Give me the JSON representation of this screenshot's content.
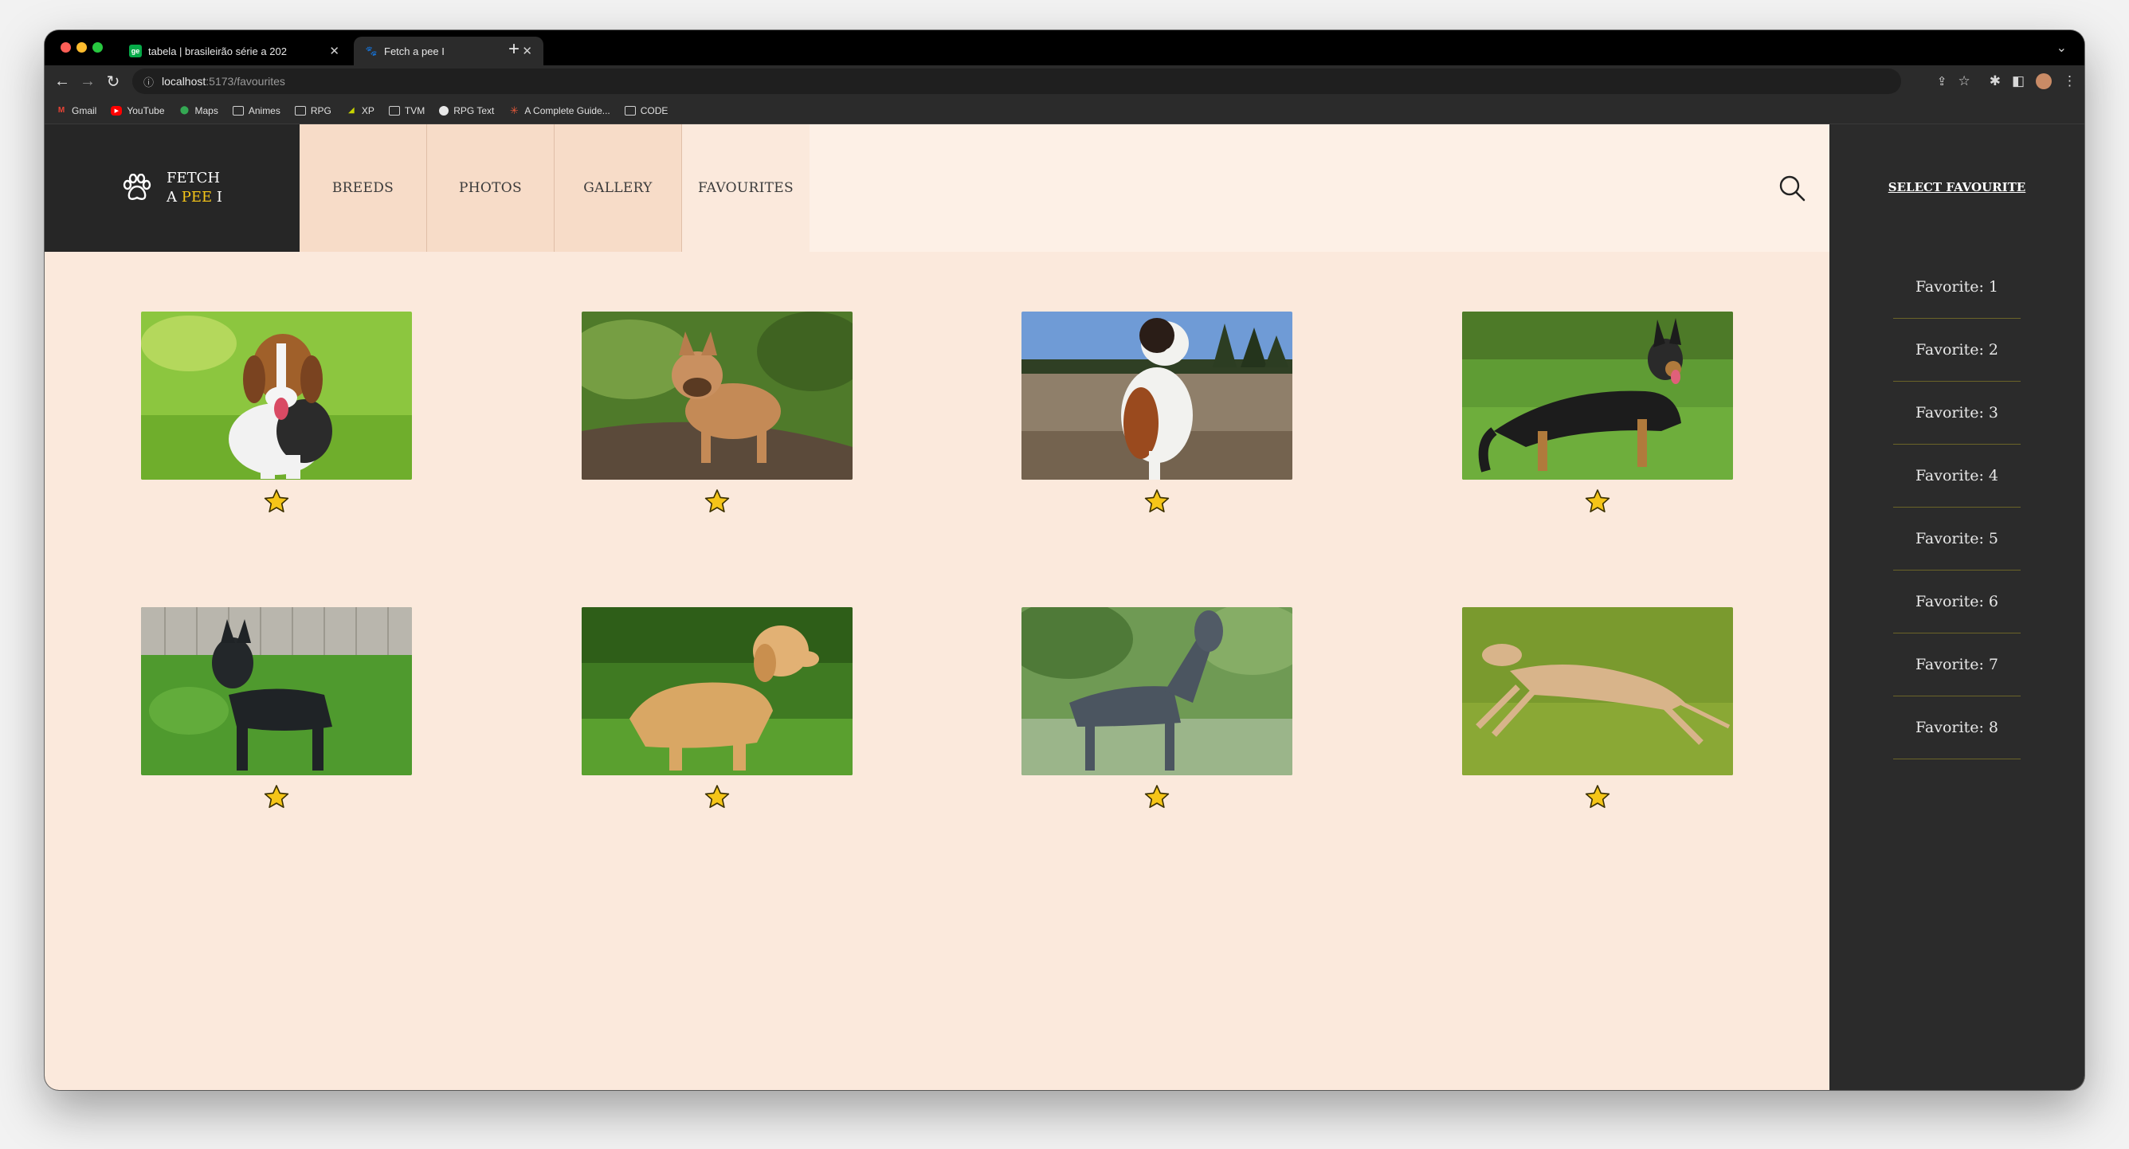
{
  "browser": {
    "tabs": [
      {
        "title": "tabela | brasileirão série a 202",
        "favicon": "ge-icon"
      },
      {
        "title": "Fetch a pee I",
        "favicon": "paw-icon"
      }
    ],
    "url_host": "localhost",
    "url_path": ":5173/favourites",
    "bookmarks": [
      {
        "label": "Gmail",
        "icon": "gmail-icon"
      },
      {
        "label": "YouTube",
        "icon": "youtube-icon"
      },
      {
        "label": "Maps",
        "icon": "maps-icon"
      },
      {
        "label": "Animes",
        "icon": "folder-icon"
      },
      {
        "label": "RPG",
        "icon": "folder-icon"
      },
      {
        "label": "XP",
        "icon": "xp-icon"
      },
      {
        "label": "TVM",
        "icon": "folder-icon"
      },
      {
        "label": "RPG Text",
        "icon": "github-icon"
      },
      {
        "label": "A Complete Guide...",
        "icon": "asterisk-icon"
      },
      {
        "label": "CODE",
        "icon": "folder-icon"
      }
    ],
    "colors": {
      "chrome": "#000000",
      "toolbar": "#2b2b2b"
    }
  },
  "app": {
    "brand_line1": "FETCH",
    "brand_line2_prefix": "A ",
    "brand_line2_accent": "PEE",
    "brand_line2_suffix": " I",
    "nav": [
      "BREEDS",
      "PHOTOS",
      "GALLERY",
      "FAVOURITES"
    ],
    "sidebar_title": "SELECT FAVOURITE",
    "favorites": [
      "Favorite: 1",
      "Favorite: 2",
      "Favorite: 3",
      "Favorite: 4",
      "Favorite: 5",
      "Favorite: 6",
      "Favorite: 7",
      "Favorite: 8"
    ],
    "dogs": [
      {
        "name": "beagle-photo"
      },
      {
        "name": "french-bulldog-photo"
      },
      {
        "name": "saint-bernard-photo"
      },
      {
        "name": "german-shepherd-photo"
      },
      {
        "name": "giant-schnauzer-photo"
      },
      {
        "name": "golden-retriever-photo"
      },
      {
        "name": "great-dane-photo"
      },
      {
        "name": "greyhound-photo"
      }
    ],
    "colors": {
      "page_bg": "#fbe9dc",
      "header_bg": "#fdf0e6",
      "brand_bg": "#262626",
      "accent": "#f5c518",
      "sidebar_bg": "#2b2b2b",
      "star": "#f5c518"
    }
  }
}
